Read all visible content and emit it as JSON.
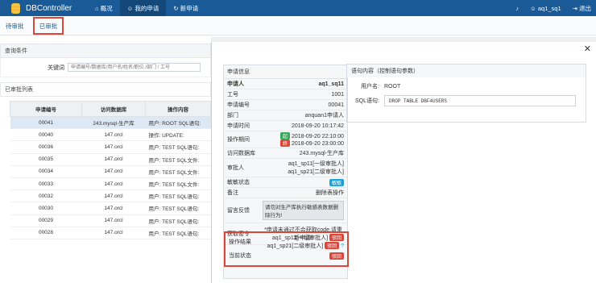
{
  "app": {
    "name": "DBController"
  },
  "nav": [
    {
      "label": "概况",
      "icon": "home-icon"
    },
    {
      "label": "我的申请",
      "icon": "user-icon"
    },
    {
      "label": "新申请",
      "icon": "refresh-icon"
    }
  ],
  "topright": {
    "user": "aq1_sq1",
    "logout": "退出"
  },
  "subtabs": {
    "pending": "待审批",
    "approved": "已审批"
  },
  "search": {
    "section": "查询条件",
    "keyword_label": "关键词",
    "placeholder": "申请编号/数据库/用户名/姓名/职位 /部门 / 工号"
  },
  "list": {
    "title": "已审批列表",
    "headers": [
      "申请编号",
      "访问数据库",
      "操作内容"
    ],
    "rows": [
      [
        "00041",
        "243.mysql-生产库",
        "用户: ROOT SQL语句:"
      ],
      [
        "00040",
        "147.orcl",
        "操作: UPDATE:"
      ],
      [
        "00036",
        "147.orcl",
        "用户: TEST SQL语句:"
      ],
      [
        "00035",
        "147.orcl",
        "用户: TEST SQL文件:"
      ],
      [
        "00034",
        "147.orcl",
        "用户: TEST SQL文件:"
      ],
      [
        "00033",
        "147.orcl",
        "用户: TEST SQL文件:"
      ],
      [
        "00032",
        "147.orcl",
        "用户: TEST SQL语句:"
      ],
      [
        "00030",
        "147.orcl",
        "用户: TEST SQL语句:"
      ],
      [
        "00029",
        "147.orcl",
        "用户: TEST SQL语句:"
      ],
      [
        "00028",
        "147.orcl",
        "用户: TEST SQL语句:"
      ]
    ]
  },
  "detail": {
    "title": "申请信息",
    "applicant_label": "申请人",
    "applicant": "aq1_sq11",
    "rows": [
      [
        "工号",
        "1001"
      ],
      [
        "申请编号",
        "00041"
      ],
      [
        "部门",
        "anquan1申请人"
      ],
      [
        "申请时间",
        "2018-09-20 10:17:42"
      ]
    ],
    "period_label": "操作期间",
    "start_badge": "起",
    "start": "2018-09-20 22:10:00",
    "end_badge": "终",
    "end": "2018-09-20 23:00:00",
    "db_label": "访问数据库",
    "db": "243.mysql-生产库",
    "approver_label": "审批人",
    "approver1": "aq1_sp11[一级审批人]",
    "approver2": "aq1_sp21[二级审批人]",
    "sens_label": "敏敏状态",
    "sens_badge": "敏敏",
    "remark_label": "备注",
    "remark": "删除表操作",
    "reason_label": "留言反馈",
    "reason": "请勿对生产库执行敏感表数据删除行为!",
    "code_label": "获取密令",
    "code": "*申请未通过不会获取code,请重新申请!",
    "result_label": "操作结果",
    "result1": "aq1_sp11[一级审批人]",
    "result2": "aq1_sp21[二级审批人]",
    "reject": "驳回",
    "status_label": "当前状态",
    "status": "驳回"
  },
  "content": {
    "title": "语句内容（控制语句参数）",
    "user_label": "用户名:",
    "user": "ROOT",
    "sql_label": "SQL语句:",
    "sql": "DROP TABLE DBF4USERS"
  },
  "colors": {
    "brand": "#1a5a96",
    "reject": "#d9463a",
    "approve": "#3aa85a",
    "info": "#1ba1d6"
  }
}
